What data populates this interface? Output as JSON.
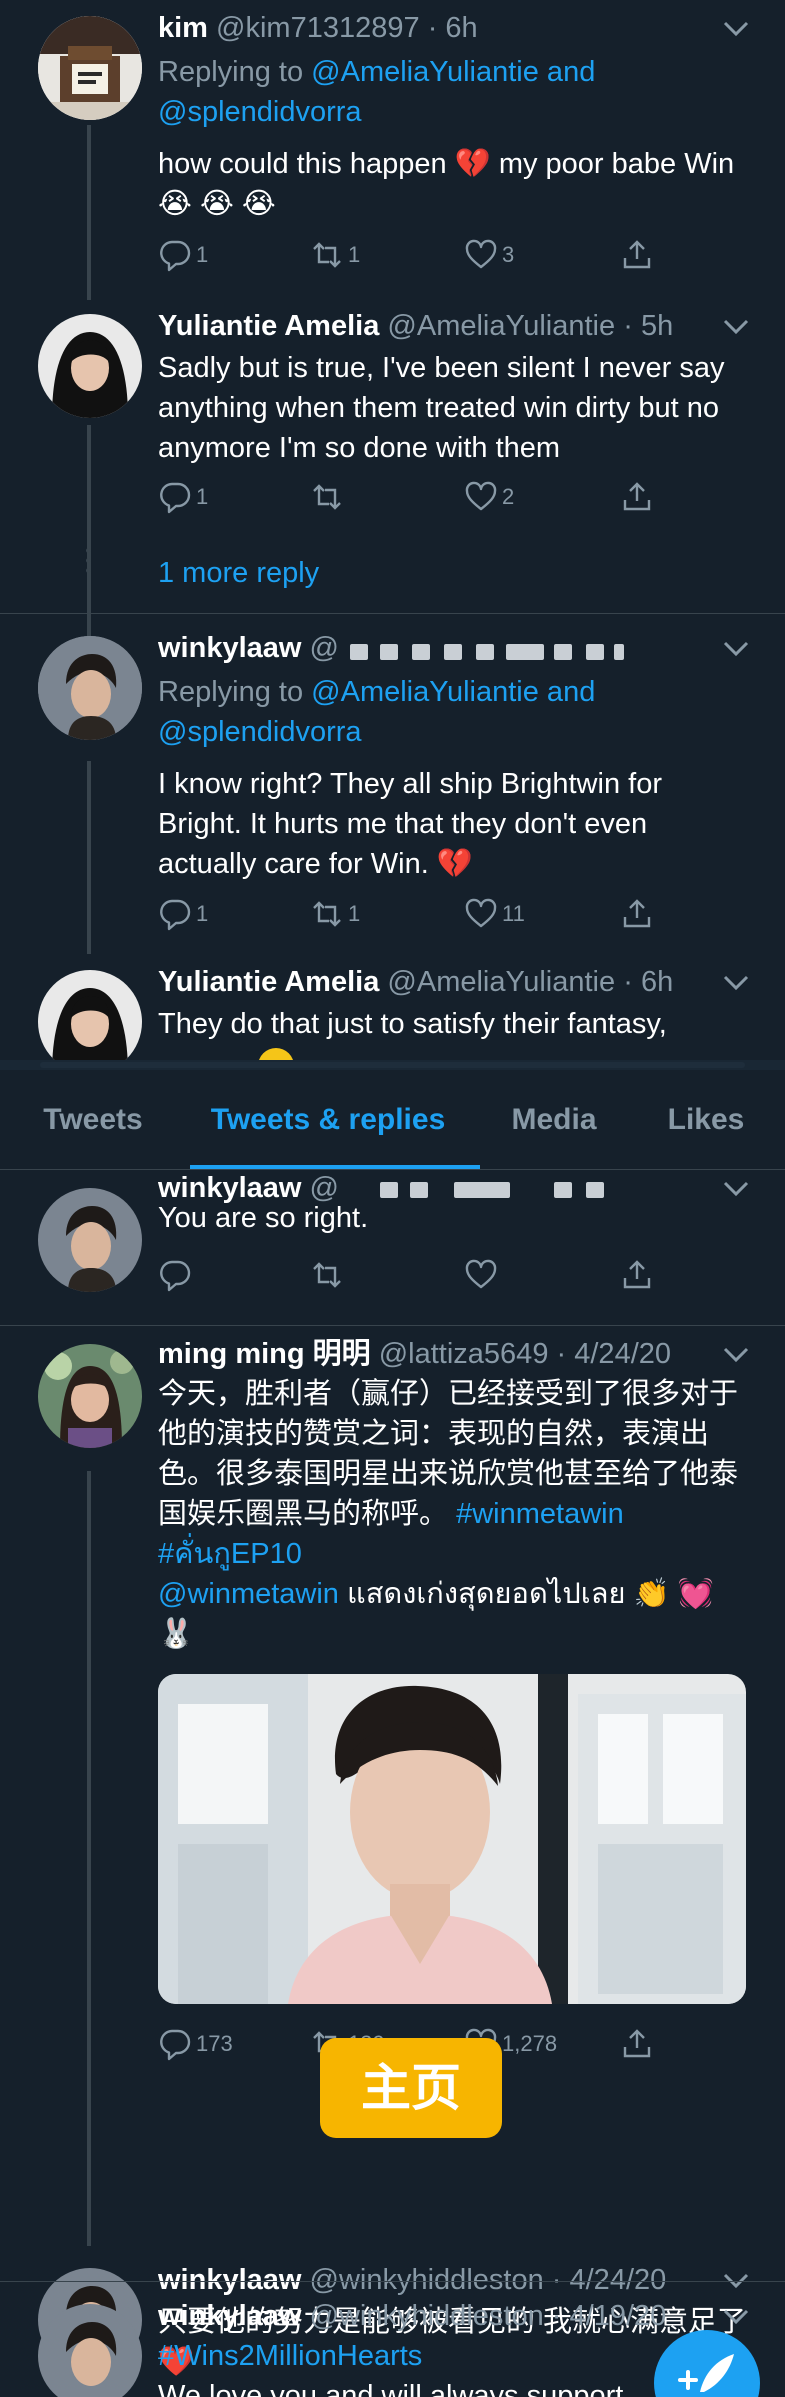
{
  "upper_section": {
    "tweets": [
      {
        "name": "kim",
        "handle": "@kim71312897",
        "time": "6h",
        "replying_prefix": "Replying to ",
        "replying_targets": "@AmeliaYuliantie and @splendidvorra",
        "text": "how could this happen 💔 my poor babe Win 😭 😭 😭",
        "reply_count": "1",
        "retweet_count": "1",
        "like_count": "3"
      },
      {
        "name": "Yuliantie Amelia",
        "handle": "@AmeliaYuliantie",
        "time": "5h",
        "text": "Sadly but is true, I've been silent I never say anything when them treated win dirty but no anymore I'm so done with them",
        "reply_count": "1",
        "retweet_count": "",
        "like_count": "2"
      }
    ],
    "more_replies": "1 more reply",
    "tweet3": {
      "name": "winkylaaw",
      "handle_visible": "@",
      "replying_prefix": "Replying to ",
      "replying_targets": "@AmeliaYuliantie and @splendidvorra",
      "text": "I know right? They all ship Brightwin for Bright. It hurts me  that they don't even actually care for Win. 💔",
      "reply_count": "1",
      "retweet_count": "1",
      "like_count": "11"
    },
    "tweet4": {
      "name": "Yuliantie Amelia",
      "handle": "@AmeliaYuliantie",
      "time": "6h",
      "text": "They do that just to satisfy their fantasy,"
    }
  },
  "tabs": [
    {
      "label": "Tweets",
      "active": false
    },
    {
      "label": "Tweets & replies",
      "active": true
    },
    {
      "label": "Media",
      "active": false
    },
    {
      "label": "Likes",
      "active": false
    }
  ],
  "lower_section": {
    "tweet5": {
      "name": "winkylaaw",
      "handle_visible": "@",
      "text": "You are so right."
    },
    "tweet6": {
      "name": "ming ming 明明",
      "handle": "@lattiza5649",
      "time": "4/24/20",
      "text_line1": "今天，胜利者（赢仔）已经接受到了很多对于他的演技的赞赏之词：表现的自然，表演出色。很多泰国明星出来说欣赏他甚至给了他泰国娱乐圈黑马的称呼。",
      "hashtag1": "#winmetawin",
      "hashtag2": "#คั่นกูEP10",
      "mention": "@winmetawin",
      "thai_text": " แสดงเก่งสุดยอดไปเลย 👏 💓",
      "emoji_line": "🐰",
      "reply_count": "173",
      "retweet_count": "139",
      "like_count": "1,278"
    },
    "tweet7": {
      "name": "winkylaaw",
      "handle_visible": "@winkyhiddleston",
      "time": "4/24/20",
      "text": "只要他的努力是能够被看见的 我就心满意足了 ❤️"
    },
    "tweet8": {
      "name": "winkylaaw",
      "handle": "@winkyhiddleston",
      "time": "4/19/20",
      "hashtag": "#Wins2MillionHearts",
      "text_partial": "We love you and will always support"
    }
  },
  "toast_label": "主页",
  "colors": {
    "background": "#15202b",
    "accent": "#1da1f2",
    "muted": "#8899a6",
    "divider": "#38444d",
    "heart_red": "#e0245e",
    "toast": "#f7b500"
  },
  "icons": [
    "reply-icon",
    "retweet-icon",
    "like-icon",
    "share-icon",
    "chevron-down-icon",
    "compose-icon"
  ]
}
